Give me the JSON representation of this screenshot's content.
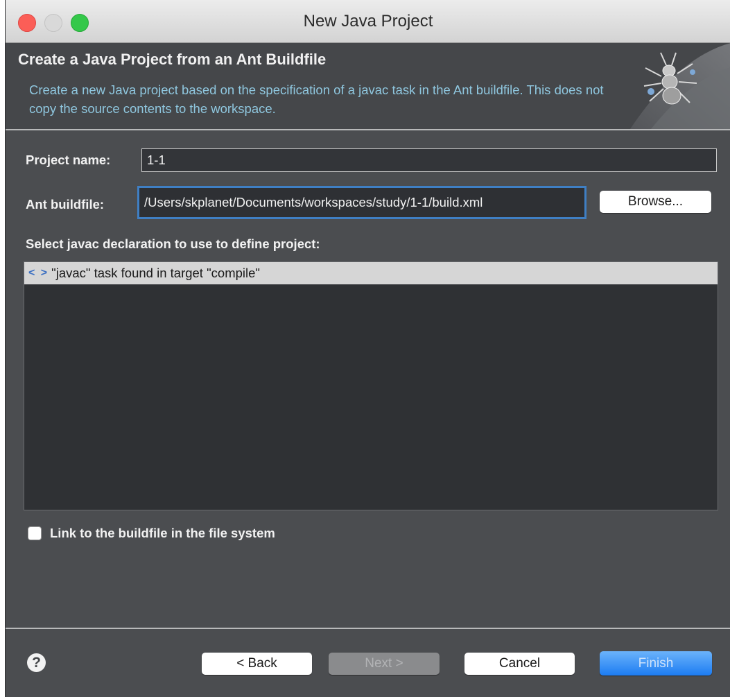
{
  "window": {
    "title": "New Java Project"
  },
  "banner": {
    "title": "Create a Java Project from an Ant Buildfile",
    "description": "Create a new Java project based on the specification of a javac task in the Ant buildfile. This does not copy the source contents to the workspace.",
    "description_color": "#8fc7df",
    "art_icon": "ant-wizard-icon"
  },
  "form": {
    "project_name_label": "Project name:",
    "project_name_value": "1-1",
    "ant_buildfile_label": "Ant buildfile:",
    "ant_buildfile_value": "/Users/skplanet/Documents/workspaces/study/1-1/build.xml",
    "browse_label": "Browse...",
    "javac_prompt": "Select javac declaration to use to define project:",
    "javac_items": [
      {
        "icon": "javac-task-icon",
        "label": "\"javac\" task found in target \"compile\""
      }
    ],
    "link_checkbox_label": "Link to the buildfile in the file system",
    "link_checkbox_checked": false
  },
  "footer": {
    "help_icon": "help-icon",
    "back_label": "< Back",
    "next_label": "Next >",
    "cancel_label": "Cancel",
    "finish_label": "Finish"
  },
  "colors": {
    "accent": "#1c7cf2",
    "focus_ring": "#3f7fc4",
    "dialog_bg": "#4b4d50"
  }
}
